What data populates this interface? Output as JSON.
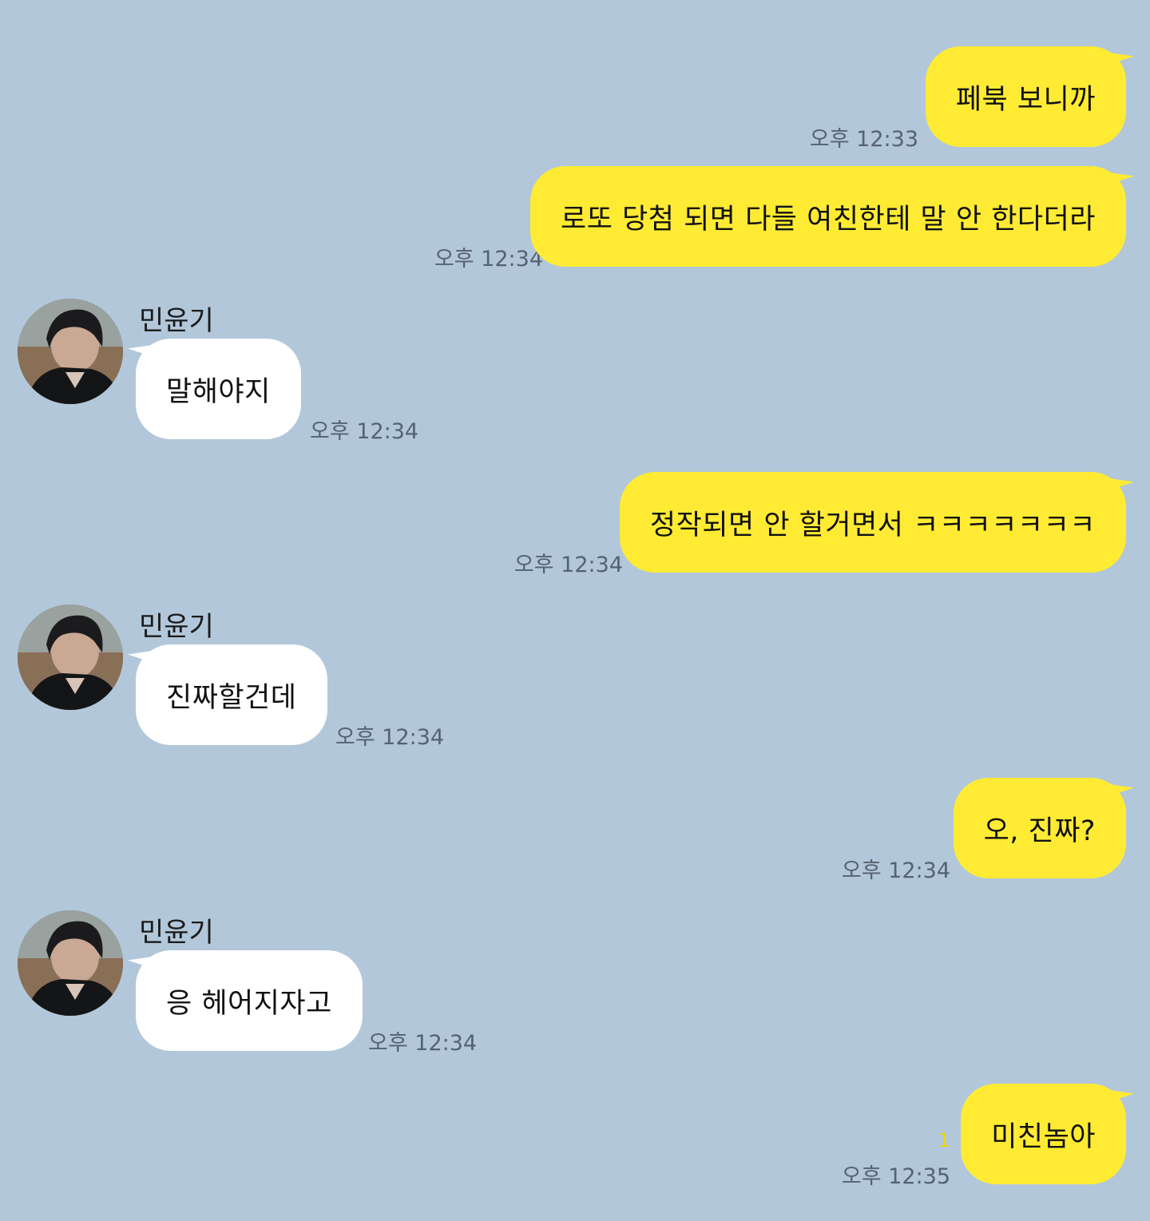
{
  "chat": {
    "messages": [
      {
        "from": "me",
        "text": "페북 보니까",
        "time": "오후 12:33"
      },
      {
        "from": "me",
        "text": "로또 당첨 되면 다들 여친한테 말 안 한다더라",
        "time": "오후 12:34"
      },
      {
        "from": "friend",
        "sender": "민윤기",
        "text": "말해야지",
        "time": "오후 12:34"
      },
      {
        "from": "me",
        "text": "정작되면 안 할거면서 ㅋㅋㅋㅋㅋㅋㅋ",
        "time": "오후 12:34"
      },
      {
        "from": "friend",
        "sender": "민윤기",
        "text": "진짜할건데",
        "time": "오후 12:34"
      },
      {
        "from": "me",
        "text": "오, 진짜?",
        "time": "오후 12:34"
      },
      {
        "from": "friend",
        "sender": "민윤기",
        "text": "응 헤어지자고",
        "time": "오후 12:34"
      },
      {
        "from": "me",
        "text": "미친놈아",
        "time": "오후 12:35",
        "unread": "1"
      }
    ]
  },
  "colors": {
    "background": "#b2c7da",
    "my_bubble": "#ffeb33",
    "friend_bubble": "#ffffff",
    "timestamp": "#556270",
    "unread_count": "#f2d600"
  },
  "icons": {
    "avatar": "profile-photo"
  }
}
